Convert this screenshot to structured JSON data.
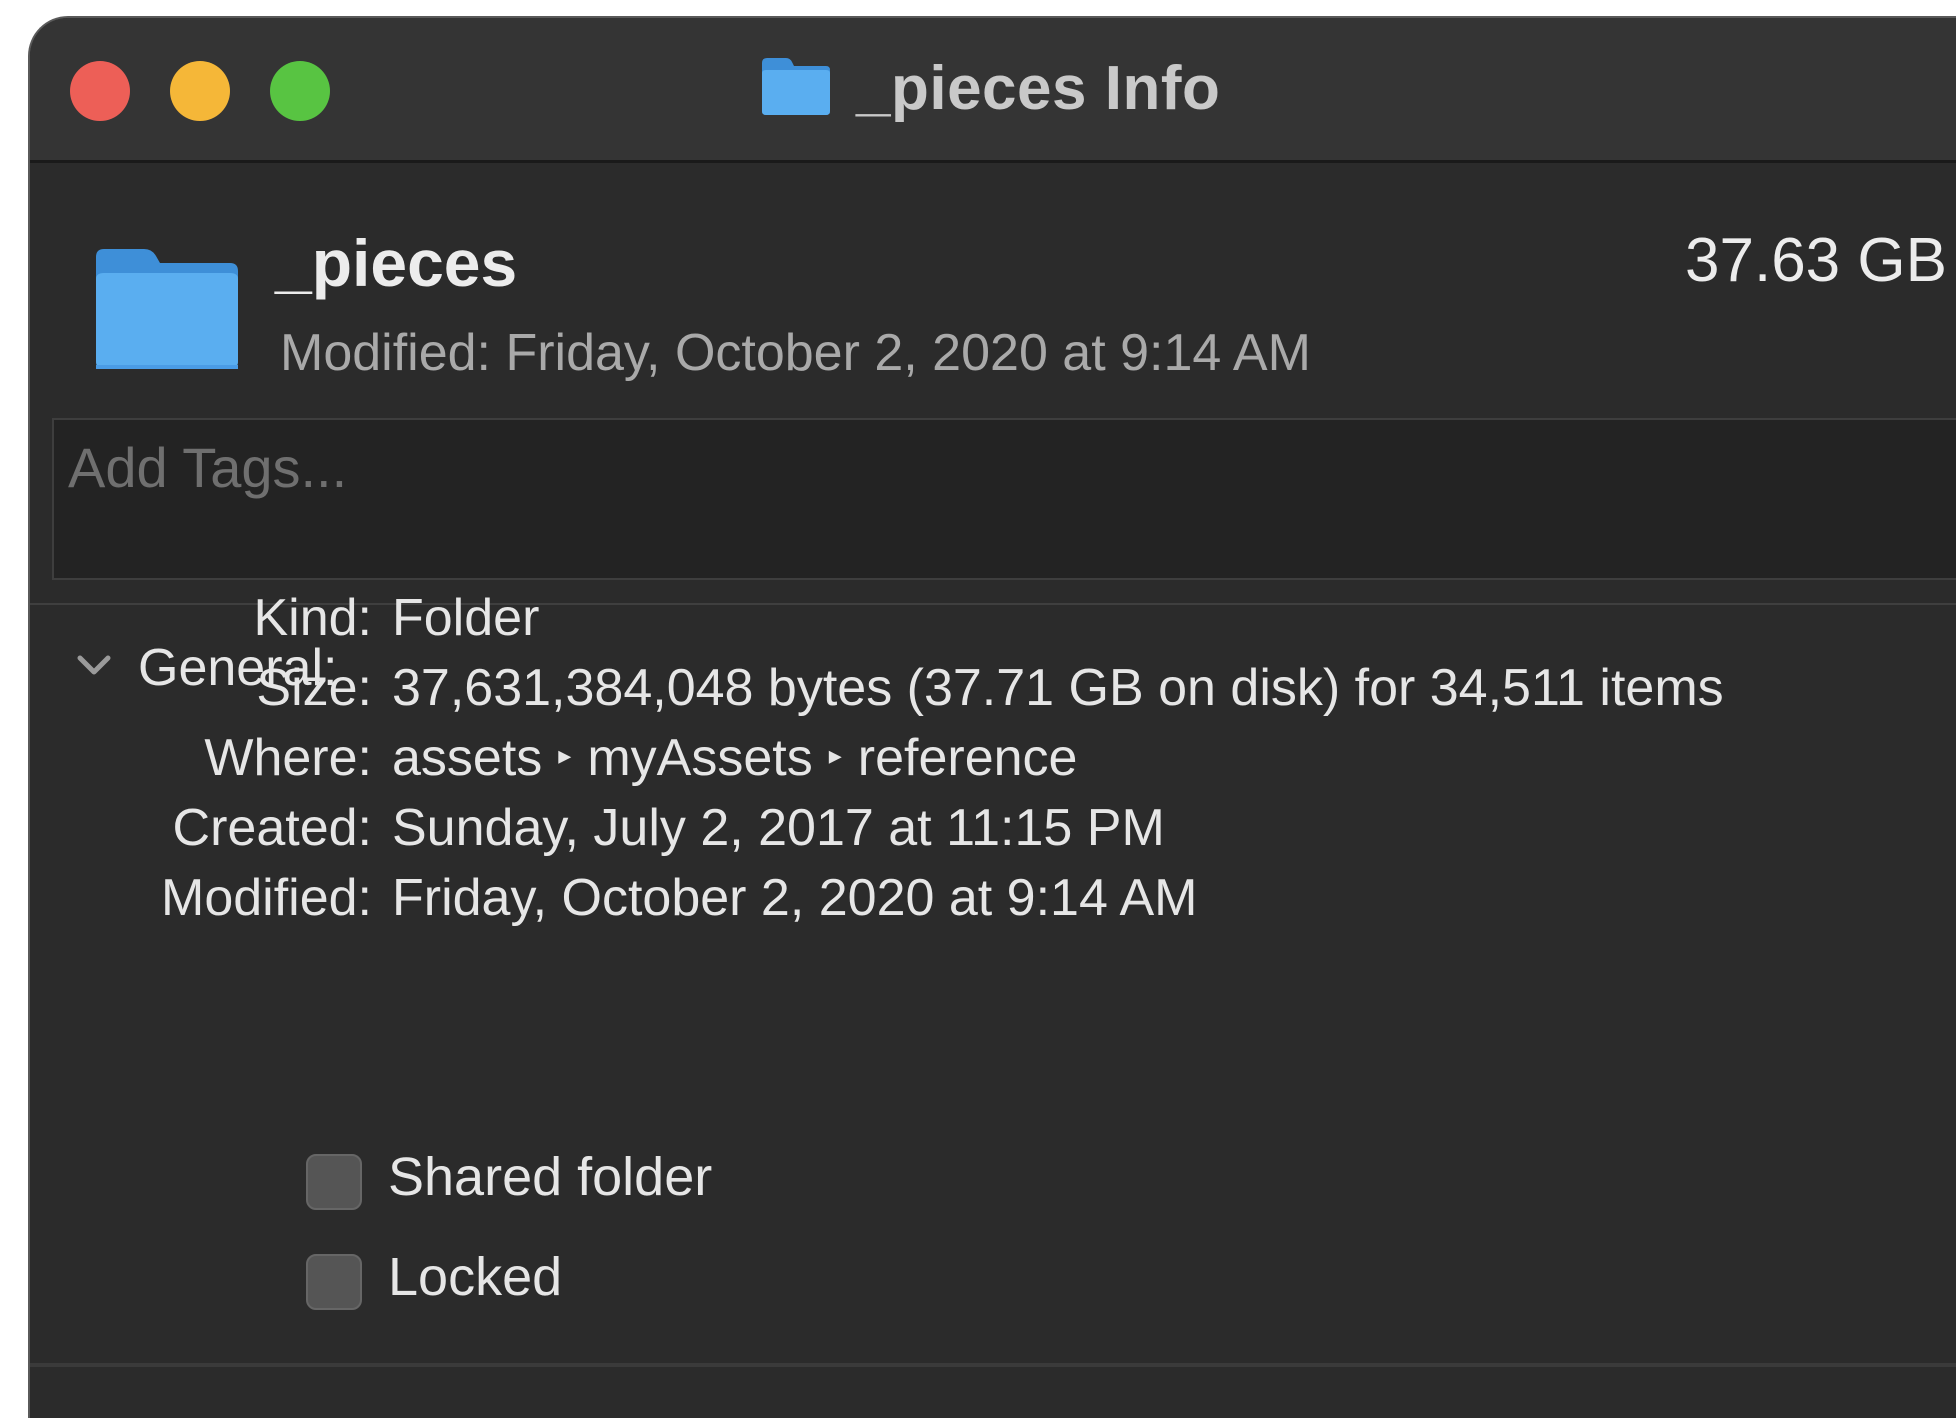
{
  "window": {
    "title": "_pieces Info"
  },
  "header": {
    "name": "_pieces",
    "size": "37.63 GB",
    "modified": "Modified: Friday, October 2, 2020 at 9:14 AM"
  },
  "tags": {
    "placeholder": "Add Tags..."
  },
  "general": {
    "label": "General:",
    "rows": [
      {
        "label": "Kind:",
        "value": "Folder"
      },
      {
        "label": "Size:",
        "value": "37,631,384,048 bytes (37.71 GB on disk) for 34,511 items"
      },
      {
        "label": "Where:",
        "path": [
          "assets",
          "myAssets",
          "reference"
        ]
      },
      {
        "label": "Created:",
        "value": "Sunday, July 2, 2017 at 11:15 PM"
      },
      {
        "label": "Modified:",
        "value": "Friday, October 2, 2020 at 9:14 AM"
      }
    ],
    "checkboxes": [
      {
        "label": "Shared folder",
        "checked": false
      },
      {
        "label": "Locked",
        "checked": false
      }
    ]
  },
  "colors": {
    "close": "#ed5f57",
    "minimize": "#f5b738",
    "zoom": "#58c442",
    "folder": "#5aaef0",
    "window_bg": "#2b2b2b"
  }
}
